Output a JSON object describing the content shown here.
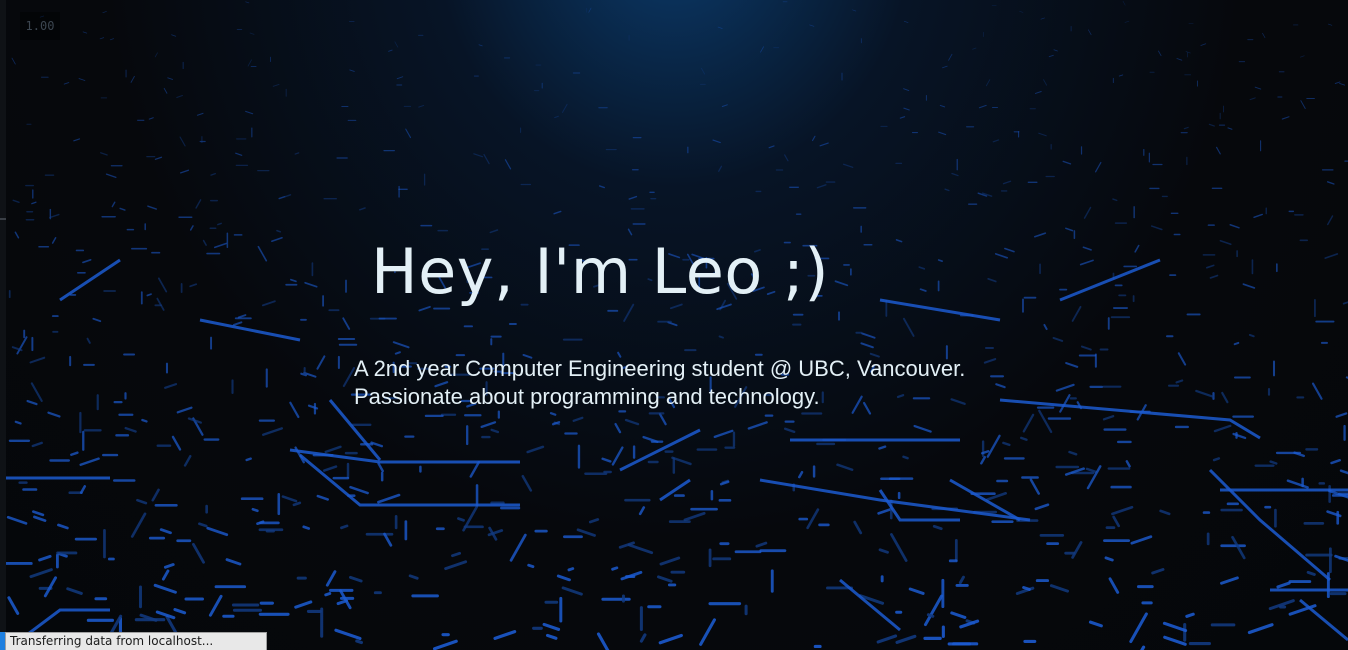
{
  "overlay": {
    "fps_value": "1.00"
  },
  "hero": {
    "title": "Hey, I'm Leo ;)",
    "description_line1": "A 2nd year Computer Engineering student @ UBC, Vancouver.",
    "description_line2": "Passionate about programming and technology."
  },
  "status_bar": {
    "text": "Transferring data from localhost..."
  },
  "colors": {
    "circuit_line": "#1c5bd0",
    "circuit_line_dim": "#123a80",
    "text": "#e3f0f6",
    "status_accent": "#1d7fe0"
  },
  "icons": {
    "background": "circuit-board-background"
  }
}
